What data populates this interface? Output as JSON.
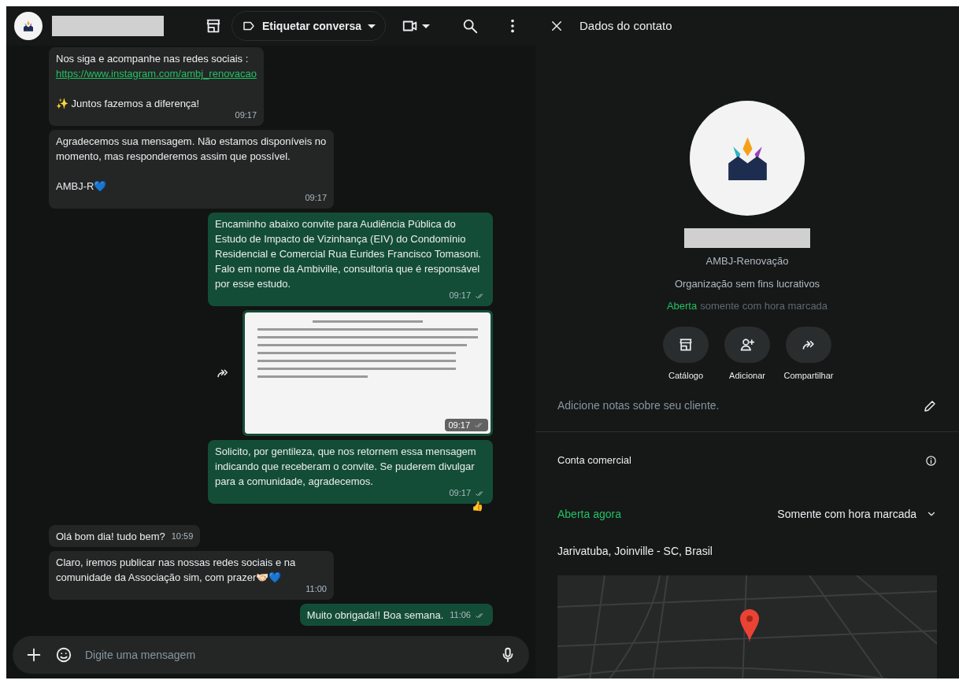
{
  "chat_header": {
    "label_button": "Etiquetar conversa"
  },
  "messages": [
    {
      "kind": "incoming",
      "parts": [
        {
          "kind": "text",
          "text": "Nos siga e acompanhe nas redes sociais :"
        },
        {
          "kind": "link",
          "text": "https://www.instagram.com/ambj_renovacao"
        },
        {
          "kind": "text",
          "text": "✨ Juntos fazemos a diferença!"
        }
      ],
      "time": "09:17"
    },
    {
      "kind": "incoming",
      "parts": [
        {
          "kind": "text",
          "text": "Agradecemos sua mensagem. Não estamos disponíveis no momento, mas responderemos assim que possível."
        },
        {
          "kind": "text",
          "text": "AMBJ-R💙"
        }
      ],
      "time": "09:17"
    },
    {
      "kind": "outgoing",
      "parts": [
        {
          "kind": "text",
          "text": "Encaminho abaixo convite para Audiência Pública do Estudo de Impacto de Vizinhança (EIV) do Condomínio Residencial e Comercial Rua Eurides Francisco Tomasoni. Falo em nome da Ambiville, consultoria que é responsável por esse estudo."
        }
      ],
      "time": "09:17",
      "read": false
    },
    {
      "kind": "image",
      "time": "09:17",
      "read": false
    },
    {
      "kind": "outgoing",
      "parts": [
        {
          "kind": "text",
          "text": "Solicito, por gentileza, que nos retornem essa mensagem indicando que receberam o convite. Se puderem divulgar para a comunidade, agradecemos."
        }
      ],
      "time": "09:17",
      "read": false,
      "reaction": "👍"
    },
    {
      "kind": "incoming",
      "parts": [
        {
          "kind": "text",
          "text": "Olá bom dia! tudo bem?"
        }
      ],
      "time": "10:59"
    },
    {
      "kind": "incoming",
      "parts": [
        {
          "kind": "text",
          "text": "Claro, iremos publicar nas nossas redes sociais e na comunidade da Associação sim, com prazer🤝🏻💙"
        }
      ],
      "time": "11:00"
    },
    {
      "kind": "outgoing",
      "parts": [
        {
          "kind": "text",
          "text": "Muito obrigada!! Boa semana."
        }
      ],
      "time": "11:06",
      "read": false
    }
  ],
  "composer": {
    "placeholder": "Digite uma mensagem"
  },
  "contact_panel": {
    "title": "Dados do contato",
    "subtitle": "AMBJ-Renovação",
    "category": "Organização sem fins lucrativos",
    "status_open": "Aberta",
    "status_hours": "somente com hora marcada",
    "actions": [
      {
        "kind": "catalog",
        "label": "Catálogo"
      },
      {
        "kind": "add",
        "label": "Adicionar"
      },
      {
        "kind": "share",
        "label": "Compartilhar"
      }
    ],
    "notes_placeholder": "Adicione notas sobre seu cliente.",
    "business_heading": "Conta comercial",
    "open_now": "Aberta agora",
    "hours": "Somente com hora marcada",
    "address": "Jarivatuba, Joinville - SC, Brasil"
  }
}
